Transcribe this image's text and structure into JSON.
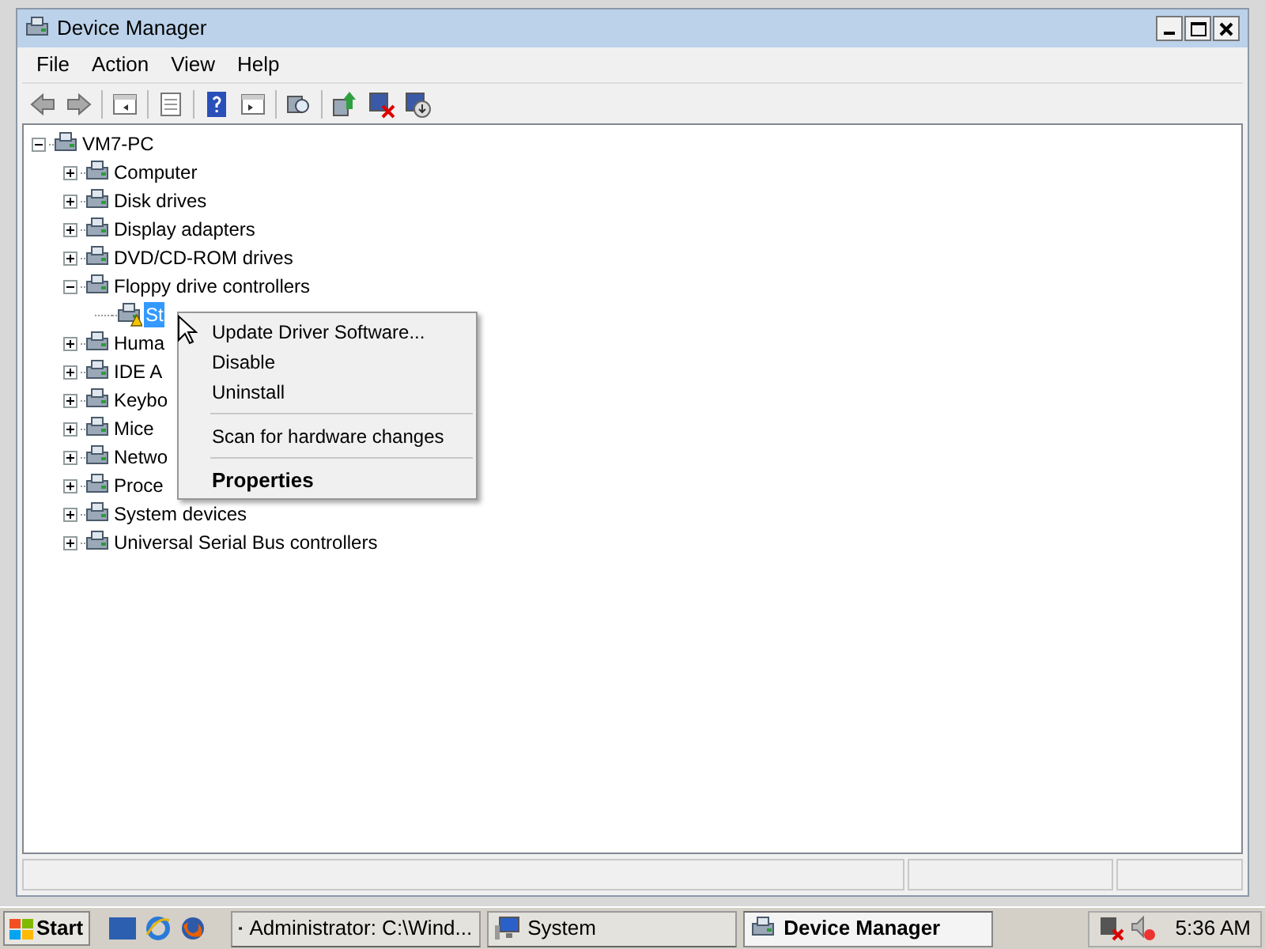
{
  "window": {
    "title": "Device Manager"
  },
  "menu_bar": [
    "File",
    "Action",
    "View",
    "Help"
  ],
  "tree": {
    "label": "VM7-PC",
    "expanded": true,
    "selected": false,
    "children": [
      {
        "label": "Computer",
        "expanded": false,
        "selected": false
      },
      {
        "label": "Disk drives",
        "expanded": false,
        "selected": false
      },
      {
        "label": "Display adapters",
        "expanded": false,
        "selected": false
      },
      {
        "label": "DVD/CD-ROM drives",
        "expanded": false,
        "selected": false
      },
      {
        "label": "Floppy drive controllers",
        "expanded": true,
        "selected": false,
        "children": [
          {
            "label": "St",
            "selected": true,
            "warning": true
          }
        ]
      },
      {
        "label": "Huma",
        "expanded": false,
        "selected": false
      },
      {
        "label": "IDE A",
        "expanded": false,
        "selected": false
      },
      {
        "label": "Keybo",
        "expanded": false,
        "selected": false
      },
      {
        "label": "Mice",
        "expanded": false,
        "selected": false
      },
      {
        "label": "Netwo",
        "expanded": false,
        "selected": false
      },
      {
        "label": "Proce",
        "expanded": false,
        "selected": false
      },
      {
        "label": "System devices",
        "expanded": false,
        "selected": false
      },
      {
        "label": "Universal Serial Bus controllers",
        "expanded": false,
        "selected": false
      }
    ]
  },
  "context_menu": [
    {
      "kind": "item",
      "label": "Update Driver Software...",
      "default": false
    },
    {
      "kind": "item",
      "label": "Disable",
      "default": false
    },
    {
      "kind": "item",
      "label": "Uninstall",
      "default": false
    },
    {
      "kind": "separator"
    },
    {
      "kind": "item",
      "label": "Scan for hardware changes",
      "default": false
    },
    {
      "kind": "separator"
    },
    {
      "kind": "item",
      "label": "Properties",
      "default": true
    }
  ],
  "taskbar": {
    "start": "Start",
    "tasks": [
      {
        "label": "Administrator: C:\\Wind...",
        "kind": "console",
        "selected": false
      },
      {
        "label": "System",
        "kind": "system",
        "selected": false
      },
      {
        "label": "Device Manager",
        "kind": "devmgr",
        "selected": true
      }
    ],
    "clock": "5:36 AM"
  }
}
